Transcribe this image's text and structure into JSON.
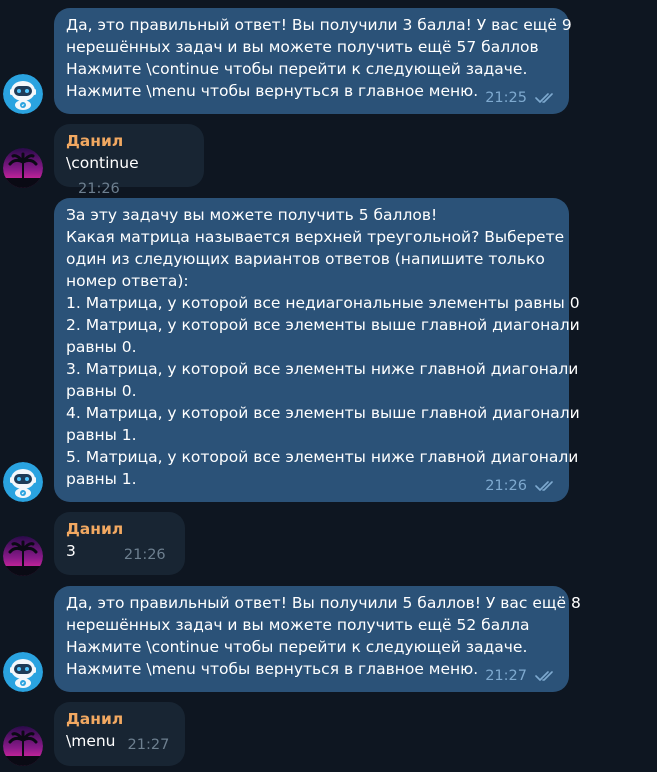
{
  "messages": [
    {
      "from": "bot",
      "lines": [
        "Да, это правильный ответ! Вы получили 3 балла! У вас ещё 9",
        "нерешённых задач и вы можете получить ещё 57 баллов",
        "Нажмите \\continue чтобы перейти к следующей задаче.",
        "Нажмите \\menu чтобы вернуться в главное меню."
      ],
      "time": "21:25"
    },
    {
      "from": "user",
      "sender": "Данил",
      "text": "\\continue",
      "time": "21:26"
    },
    {
      "from": "bot",
      "lines": [
        "За эту задачу вы можете получить 5 баллов!",
        "Какая матрица называется верхней треугольной? Выберете",
        "один из следующих вариантов ответов (напишите только",
        "номер ответа):",
        "1. Матрица, у которой все недиагональные элементы равны 0",
        "2. Матрица, у которой все элементы выше главной диагонали",
        "равны 0.",
        "3. Матрица, у которой все элементы ниже главной диагонали",
        "равны 0.",
        "4. Матрица, у которой все элементы выше главной диагонали",
        "равны 1.",
        "5. Матрица, у которой все элементы ниже главной диагонали",
        "равны 1."
      ],
      "time": "21:26"
    },
    {
      "from": "user",
      "sender": "Данил",
      "text": "3",
      "time": "21:26"
    },
    {
      "from": "bot",
      "lines": [
        "Да, это правильный ответ! Вы получили 5 баллов! У вас ещё 8",
        "нерешённых задач и вы можете получить ещё 52 балла",
        "Нажмите \\continue чтобы перейти к следующей задаче.",
        "Нажмите \\menu чтобы вернуться в главное меню."
      ],
      "time": "21:27"
    },
    {
      "from": "user",
      "sender": "Данил",
      "text": "\\menu",
      "time": "21:27"
    }
  ],
  "icons": {
    "bot_avatar": "robot-icon",
    "user_avatar": "palm-sunset-icon",
    "read_status": "double-check-icon"
  },
  "colors": {
    "background": "#0e1621",
    "bot_bubble": "#2b5278",
    "user_bubble": "#182533",
    "sender_name": "#f1a861",
    "bot_meta": "#7ea9cf",
    "user_meta": "#6d7f8f"
  }
}
